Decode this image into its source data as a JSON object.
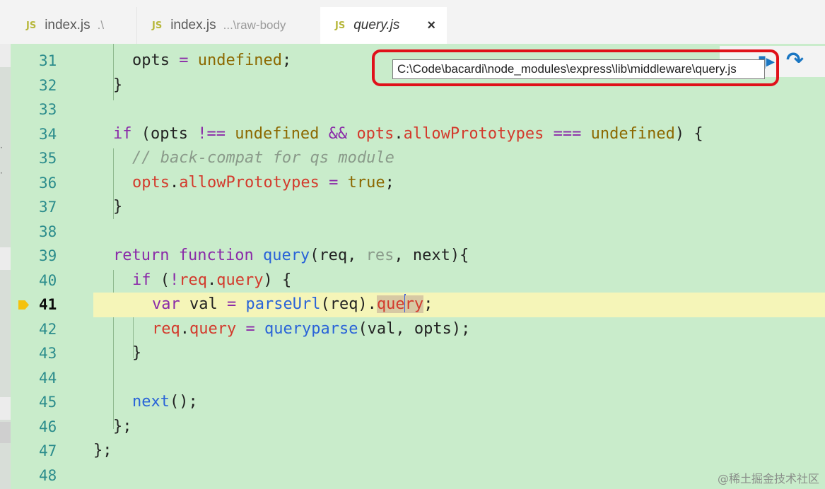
{
  "tabs": [
    {
      "icon": "JS",
      "name": "index.js",
      "path": ".\\"
    },
    {
      "icon": "JS",
      "name": "index.js",
      "path": "...\\raw-body"
    },
    {
      "icon": "JS",
      "name": "query.js",
      "close": "×"
    }
  ],
  "tooltip": {
    "text": "C:\\Code\\bacardi\\node_modules\\express\\lib\\middleware\\query.js"
  },
  "debug_toolbar": {
    "partial_icon": "continue-icon",
    "step_over_icon": "step-over-icon",
    "step_over_glyph": "↷"
  },
  "editor": {
    "current_line": 41,
    "lines": [
      {
        "num": "31"
      },
      {
        "num": "32"
      },
      {
        "num": "33"
      },
      {
        "num": "34"
      },
      {
        "num": "35"
      },
      {
        "num": "36"
      },
      {
        "num": "37"
      },
      {
        "num": "38"
      },
      {
        "num": "39"
      },
      {
        "num": "40"
      },
      {
        "num": "41"
      },
      {
        "num": "42"
      },
      {
        "num": "43"
      },
      {
        "num": "44"
      },
      {
        "num": "45"
      },
      {
        "num": "46"
      },
      {
        "num": "47"
      },
      {
        "num": "48"
      }
    ],
    "code": {
      "l31": [
        "opts",
        " = ",
        "undefined",
        ";"
      ],
      "l32": [
        "}"
      ],
      "l34": [
        "if",
        " (opts ",
        "!==",
        " ",
        "undefined",
        " ",
        "&&",
        " ",
        "opts",
        ".",
        "allowPrototypes",
        " ",
        "===",
        " ",
        "undefined",
        ") {"
      ],
      "l35": [
        "// back-compat for qs module"
      ],
      "l36": [
        "opts",
        ".",
        "allowPrototypes",
        " ",
        "=",
        " ",
        "true",
        ";"
      ],
      "l37": [
        "}"
      ],
      "l39": [
        "return",
        " ",
        "function",
        " ",
        "query",
        "(req, ",
        "res",
        ", next){"
      ],
      "l40": [
        "if",
        " (",
        "!",
        "req",
        ".",
        "query",
        ") {"
      ],
      "l41": [
        "var",
        " val ",
        "=",
        " ",
        "parseUrl",
        "(req).",
        "que",
        "ry",
        ";"
      ],
      "l42": [
        "req",
        ".",
        "query",
        " ",
        "=",
        " ",
        "queryparse",
        "(val, opts);"
      ],
      "l43": [
        "}"
      ],
      "l45": [
        "next",
        "();"
      ],
      "l46": [
        "};"
      ],
      "l47": [
        "};"
      ]
    }
  },
  "colors": {
    "editor_bg": "#c9eccb",
    "current_line_bg": "#f5f5b8",
    "keyword": "#8a2aa8",
    "function": "#2963d8",
    "constant": "#8c6800",
    "property": "#d33a2c",
    "highlight_ring": "#e0111a"
  },
  "watermark": "@稀土掘金技术社区"
}
